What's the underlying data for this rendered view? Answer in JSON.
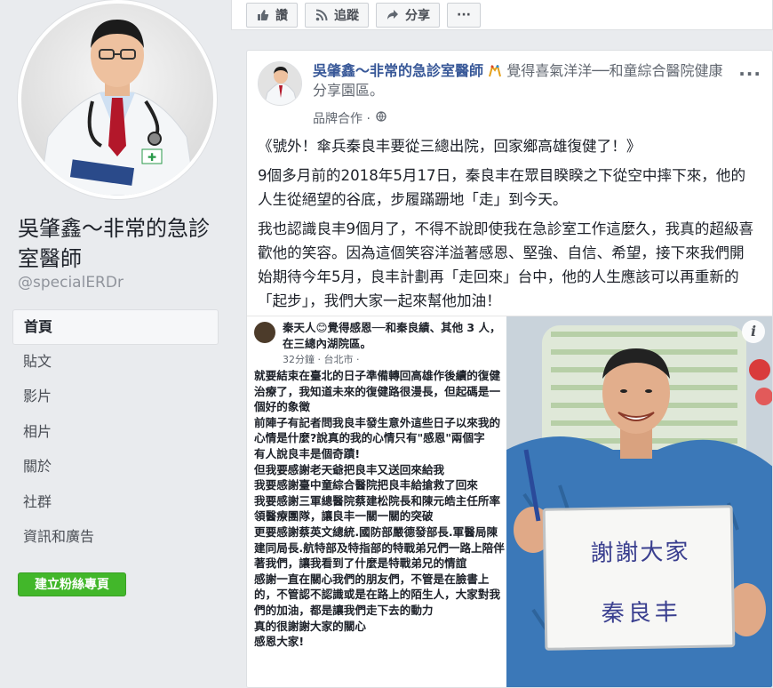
{
  "sidebar": {
    "page_name": "吳肇鑫～非常的急診室醫師",
    "handle": "@specialERDr",
    "nav": [
      {
        "label": "首頁",
        "active": true
      },
      {
        "label": "貼文"
      },
      {
        "label": "影片"
      },
      {
        "label": "相片"
      },
      {
        "label": "關於"
      },
      {
        "label": "社群"
      },
      {
        "label": "資訊和廣告"
      }
    ],
    "create_button": "建立粉絲專頁"
  },
  "actionbar": {
    "like": "讚",
    "follow": "追蹤",
    "share": "分享",
    "more": "···"
  },
  "post": {
    "author": "吳肇鑫～非常的急診室醫師",
    "activity": "覺得喜氣洋洋──和童綜合醫院健康分享園區。",
    "meta": "品牌合作 ·",
    "more": "···",
    "paragraphs": [
      "《號外！傘兵秦良丰要從三總出院，回家鄉高雄復健了！》",
      "9個多月前的2018年5月17日，秦良丰在眾目睽睽之下從空中摔下來，他的人生從絕望的谷底，步履蹣跚地「走」到今天。",
      "我也認識良丰9個月了，不得不說即使我在急診室工作這麼久，我真的超級喜歡他的笑容。因為這個笑容洋溢著感恩、堅強、自信、希望，接下來我們開始期待今年5月，良丰計劃再「走回來」台中，他的人生應該可以再重新的「起步」，我們大家一起來幫他加油！"
    ],
    "embedded": {
      "header": "秦天人😊覺得感恩──和秦良績、其他 3 人，在三總內湖院區。",
      "meta": "32分鐘 · 台北市 ·",
      "lines": [
        "就要結束在臺北的日子準備轉回高雄作後續的復健治療了，我知道未來的復健路很漫長，但起碼是一個好的象徵",
        "前陣子有記者問我良丰發生意外這些日子以來我的心情是什麼?說真的我的心情只有\"感恩\"兩個字",
        "有人說良丰是個奇蹟!",
        "但我要感謝老天爺把良丰又送回來給我",
        "我要感謝臺中童綜合醫院把良丰給搶救了回來",
        "我要感謝三軍總醫院蔡建松院長和陳元皓主任所率領醫療團隊，讓良丰一關一關的突破",
        "更要感謝蔡英文總統.國防部嚴德發部長.軍醫局陳建同局長.航特部及特指部的特戰弟兄們一路上陪伴著我們，讓我看到了什麼是特戰弟兄的情誼",
        "感謝一直在關心我們的朋友們，不管是在臉書上的，不管認不認識或是在路上的陌生人，大家對我們的加油，都是讓我們走下去的動力",
        "真的很謝謝大家的關心",
        "感恩大家!"
      ]
    },
    "whiteboard": {
      "line1": "謝謝大家",
      "line2": "秦良丰"
    },
    "info": "i"
  },
  "colors": {
    "link": "#385898",
    "green": "#42b72a",
    "bg": "#e9ebee"
  }
}
